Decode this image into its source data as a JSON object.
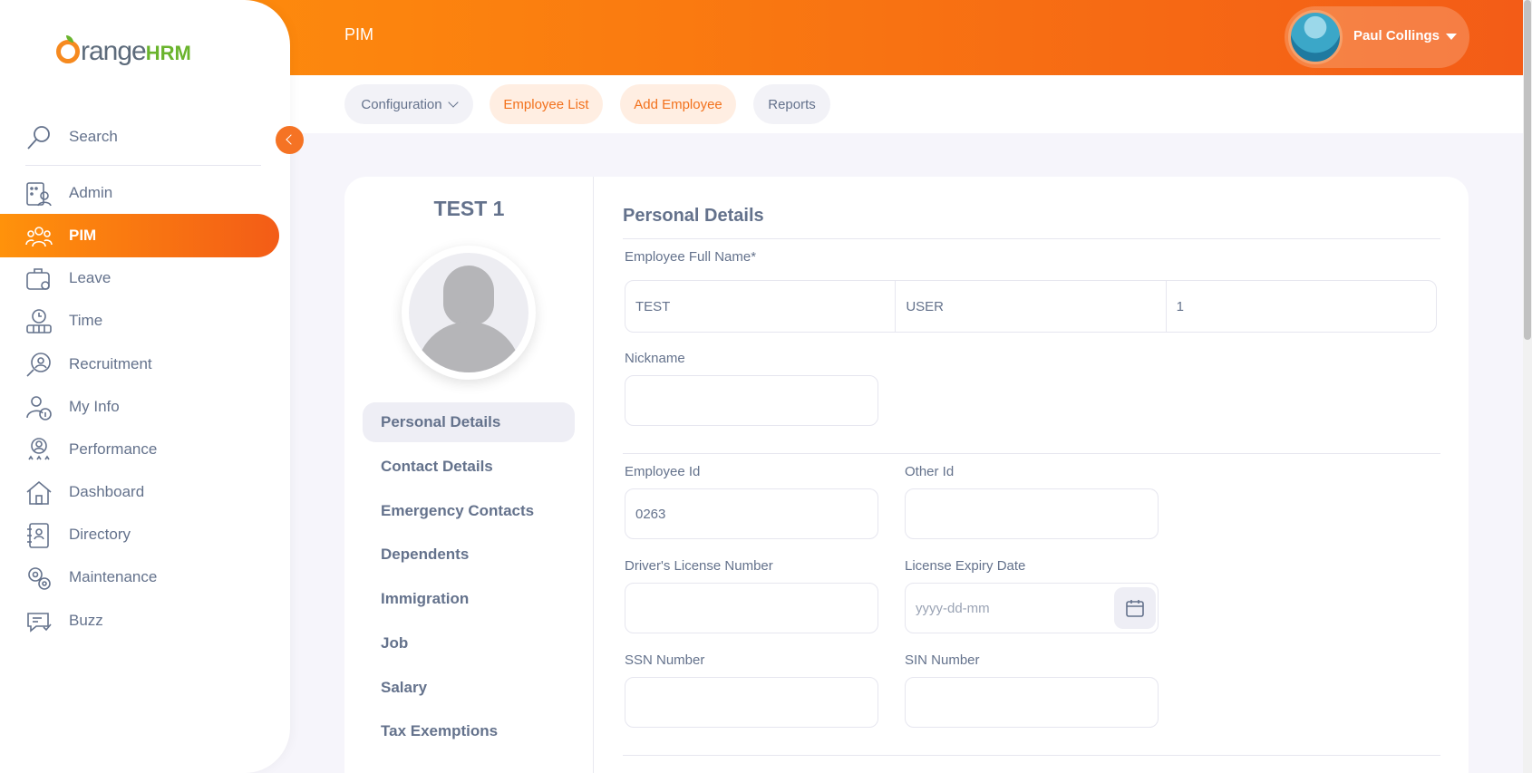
{
  "header": {
    "module_title": "PIM",
    "user_name": "Paul Collings"
  },
  "subnav": {
    "configuration": "Configuration",
    "employee_list": "Employee List",
    "add_employee": "Add Employee",
    "reports": "Reports"
  },
  "sidebar": {
    "search_label": "Search",
    "items": [
      {
        "label": "Admin",
        "icon": "admin-icon"
      },
      {
        "label": "PIM",
        "icon": "pim-icon",
        "active": true
      },
      {
        "label": "Leave",
        "icon": "leave-icon"
      },
      {
        "label": "Time",
        "icon": "time-icon"
      },
      {
        "label": "Recruitment",
        "icon": "recruitment-icon"
      },
      {
        "label": "My Info",
        "icon": "my-info-icon"
      },
      {
        "label": "Performance",
        "icon": "performance-icon"
      },
      {
        "label": "Dashboard",
        "icon": "dashboard-icon"
      },
      {
        "label": "Directory",
        "icon": "directory-icon"
      },
      {
        "label": "Maintenance",
        "icon": "maintenance-icon"
      },
      {
        "label": "Buzz",
        "icon": "buzz-icon"
      }
    ]
  },
  "employee": {
    "display_name": "TEST 1"
  },
  "side_tabs": [
    "Personal Details",
    "Contact Details",
    "Emergency Contacts",
    "Dependents",
    "Immigration",
    "Job",
    "Salary",
    "Tax Exemptions"
  ],
  "form": {
    "title": "Personal Details",
    "full_name_label": "Employee Full Name*",
    "first_name": "TEST",
    "middle_name": "USER",
    "last_name": "1",
    "nickname_label": "Nickname",
    "nickname_value": "",
    "employee_id_label": "Employee Id",
    "employee_id_value": "0263",
    "other_id_label": "Other Id",
    "other_id_value": "",
    "drivers_license_label": "Driver's License Number",
    "drivers_license_value": "",
    "license_expiry_label": "License Expiry Date",
    "license_expiry_placeholder": "yyyy-dd-mm",
    "ssn_label": "SSN Number",
    "ssn_value": "",
    "sin_label": "SIN Number",
    "sin_value": ""
  },
  "colors": {
    "accent": "#f57324",
    "accent_gradient_start": "#ff920b",
    "accent_gradient_end": "#f35c17",
    "text": "#64728c"
  }
}
